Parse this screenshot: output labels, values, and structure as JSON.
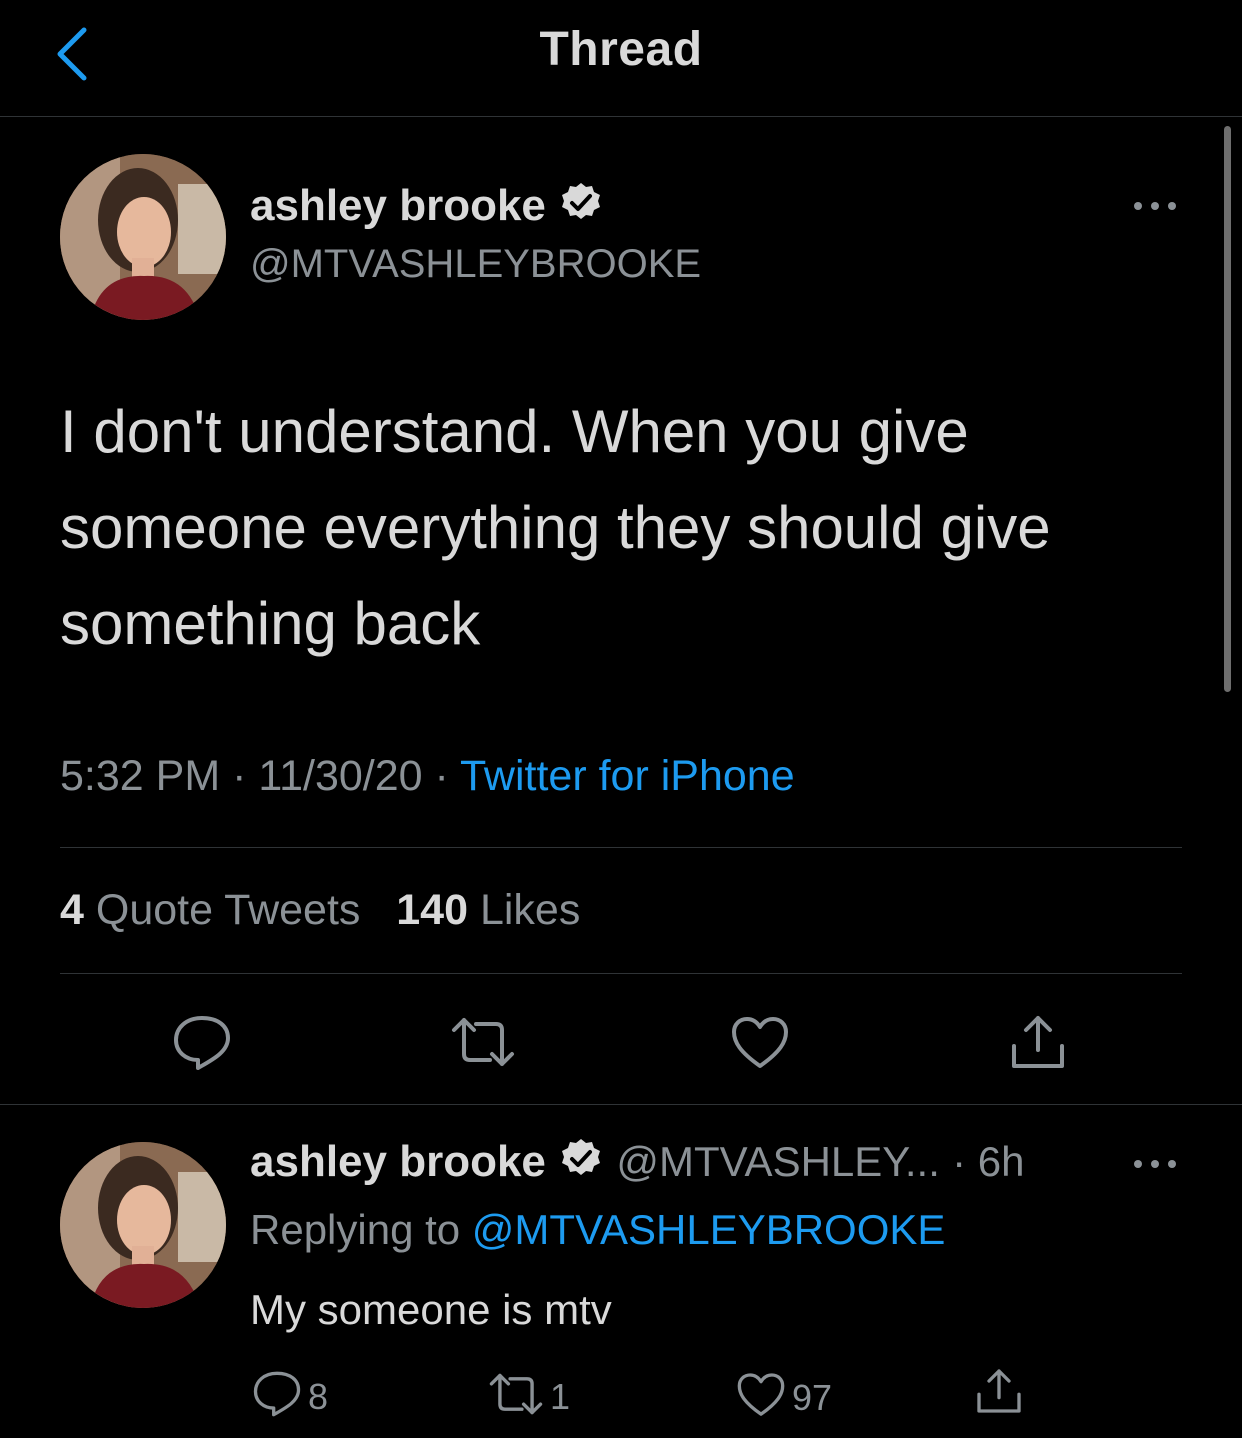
{
  "header": {
    "title": "Thread"
  },
  "main_tweet": {
    "name": "ashley brooke",
    "handle": "@MTVASHLEYBROOKE",
    "text": "I don't understand. When you give someone everything they should give something back",
    "time": "5:32 PM",
    "date": "11/30/20",
    "sep": "·",
    "source": "Twitter for iPhone",
    "quote_count": "4",
    "quote_label": "Quote Tweets",
    "like_count": "140",
    "like_label": "Likes"
  },
  "reply_tweet": {
    "name": "ashley brooke",
    "handle": "@MTVASHLEY...",
    "age": "· 6h",
    "replying_label": "Replying to",
    "replying_to": "@MTVASHLEYBROOKE",
    "text": "My someone is mtv",
    "reply_count": "8",
    "retweet_count": "1",
    "like_count": "97"
  },
  "colors": {
    "accent": "#1d9bf0",
    "background": "#000000",
    "muted": "#8b9196"
  }
}
